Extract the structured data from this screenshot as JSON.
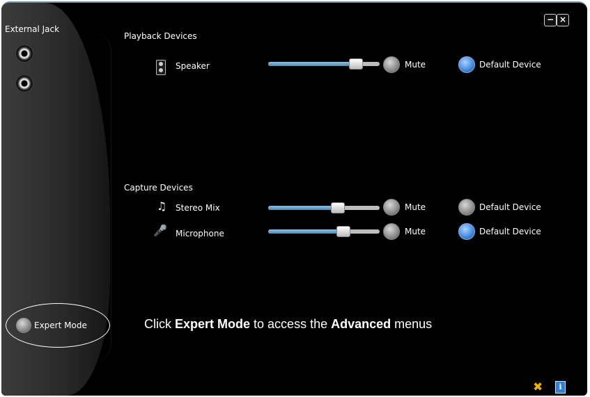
{
  "side_panel": {
    "title": "External Jack",
    "jacks": [
      "jack-port-icon",
      "jack-port-icon"
    ],
    "expert_mode_label": "Expert Mode"
  },
  "window_controls": {
    "minimize_icon": "minimize-icon",
    "close_icon": "close-icon"
  },
  "playback": {
    "title": "Playback Devices",
    "devices": [
      {
        "name": "Speaker",
        "icon": "speaker-icon",
        "volume": 0.78,
        "mute_label": "Mute",
        "mute_on": false,
        "default_label": "Default Device",
        "is_default": true
      }
    ]
  },
  "capture": {
    "title": "Capture Devices",
    "devices": [
      {
        "name": "Stereo Mix",
        "icon": "music-note-icon",
        "volume": 0.62,
        "mute_label": "Mute",
        "mute_on": false,
        "default_label": "Default Device",
        "is_default": false
      },
      {
        "name": "Microphone",
        "icon": "microphone-icon",
        "volume": 0.67,
        "mute_label": "Mute",
        "mute_on": false,
        "default_label": "Default Device",
        "is_default": true
      }
    ]
  },
  "hint": {
    "prefix": "Click ",
    "strong1": "Expert Mode",
    "middle": " to access the ",
    "strong2": "Advanced",
    "suffix": " menus"
  },
  "footer_icons": [
    "tools-icon",
    "info-icon"
  ],
  "colors": {
    "slider_fill": "#4a88b8",
    "radio_on": "#3b7fd6",
    "radio_off": "#7c7c7c",
    "background": "#000000"
  }
}
